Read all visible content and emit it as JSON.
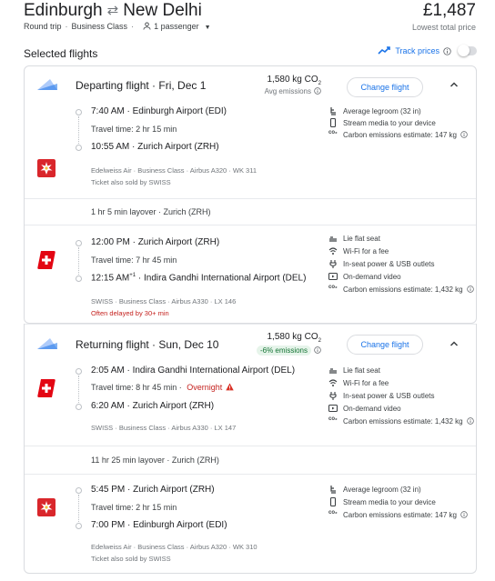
{
  "header": {
    "origin": "Edinburgh",
    "destination": "New Delhi",
    "swap_icon": "swap-arrows-icon",
    "trip_type": "Round trip",
    "cabin": "Business Class",
    "passengers": "1 passenger",
    "price": "£1,487",
    "price_label": "Lowest total price"
  },
  "selected": {
    "title": "Selected flights",
    "track_label": "Track prices",
    "track_enabled": false
  },
  "departing": {
    "title": "Departing flight · Fri, Dec 1",
    "co2": "1,580 kg CO",
    "co2_sub": "2",
    "co2_note": "Avg emissions",
    "change_label": "Change flight",
    "seg1": {
      "dep_time": "7:40 AM",
      "dep_airport": "Edinburgh Airport (EDI)",
      "travel": "Travel time: 2 hr 15 min",
      "arr_time": "10:55 AM",
      "arr_airport": "Zurich Airport (ZRH)",
      "meta": "Edelweiss Air · Business Class · Airbus A320 · WK 311",
      "sold": "Ticket also sold by SWISS",
      "amenities": [
        "Average legroom (32 in)",
        "Stream media to your device",
        "Carbon emissions estimate: 147 kg"
      ]
    },
    "layover": "1 hr 5 min layover · Zurich (ZRH)",
    "seg2": {
      "dep_time": "12:00 PM",
      "dep_airport": "Zurich Airport (ZRH)",
      "travel": "Travel time: 7 hr 45 min",
      "arr_time": "12:15 AM",
      "arr_sup": "+1",
      "arr_airport": "Indira Gandhi International Airport (DEL)",
      "meta": "SWISS · Business Class · Airbus A330 · LX 146",
      "delay": "Often delayed by 30+ min",
      "amenities": [
        "Lie flat seat",
        "Wi-Fi for a fee",
        "In-seat power & USB outlets",
        "On-demand video",
        "Carbon emissions estimate: 1,432 kg"
      ]
    }
  },
  "returning": {
    "title": "Returning flight · Sun, Dec 10",
    "co2": "1,580 kg CO",
    "co2_sub": "2",
    "co2_note": "-6% emissions",
    "change_label": "Change flight",
    "seg1": {
      "dep_time": "2:05 AM",
      "dep_airport": "Indira Gandhi International Airport (DEL)",
      "travel": "Travel time: 8 hr 45 min",
      "overnight": "Overnight",
      "arr_time": "6:20 AM",
      "arr_airport": "Zurich Airport (ZRH)",
      "meta": "SWISS · Business Class · Airbus A330 · LX 147",
      "amenities": [
        "Lie flat seat",
        "Wi-Fi for a fee",
        "In-seat power & USB outlets",
        "On-demand video",
        "Carbon emissions estimate: 1,432 kg"
      ]
    },
    "layover": "11 hr 25 min layover · Zurich (ZRH)",
    "seg2": {
      "dep_time": "5:45 PM",
      "dep_airport": "Zurich Airport (ZRH)",
      "travel": "Travel time: 2 hr 15 min",
      "arr_time": "7:00 PM",
      "arr_airport": "Edinburgh Airport (EDI)",
      "meta": "Edelweiss Air · Business Class · Airbus A320 · WK 310",
      "sold": "Ticket also sold by SWISS",
      "amenities": [
        "Average legroom (32 in)",
        "Stream media to your device",
        "Carbon emissions estimate: 147 kg"
      ]
    }
  },
  "colors": {
    "accent": "#1a73e8",
    "edelweiss": "#d9262b",
    "swiss": "#e30613",
    "warning": "#c5221f",
    "eco_badge_bg": "#e6f4ea",
    "eco_badge_text": "#137333"
  }
}
